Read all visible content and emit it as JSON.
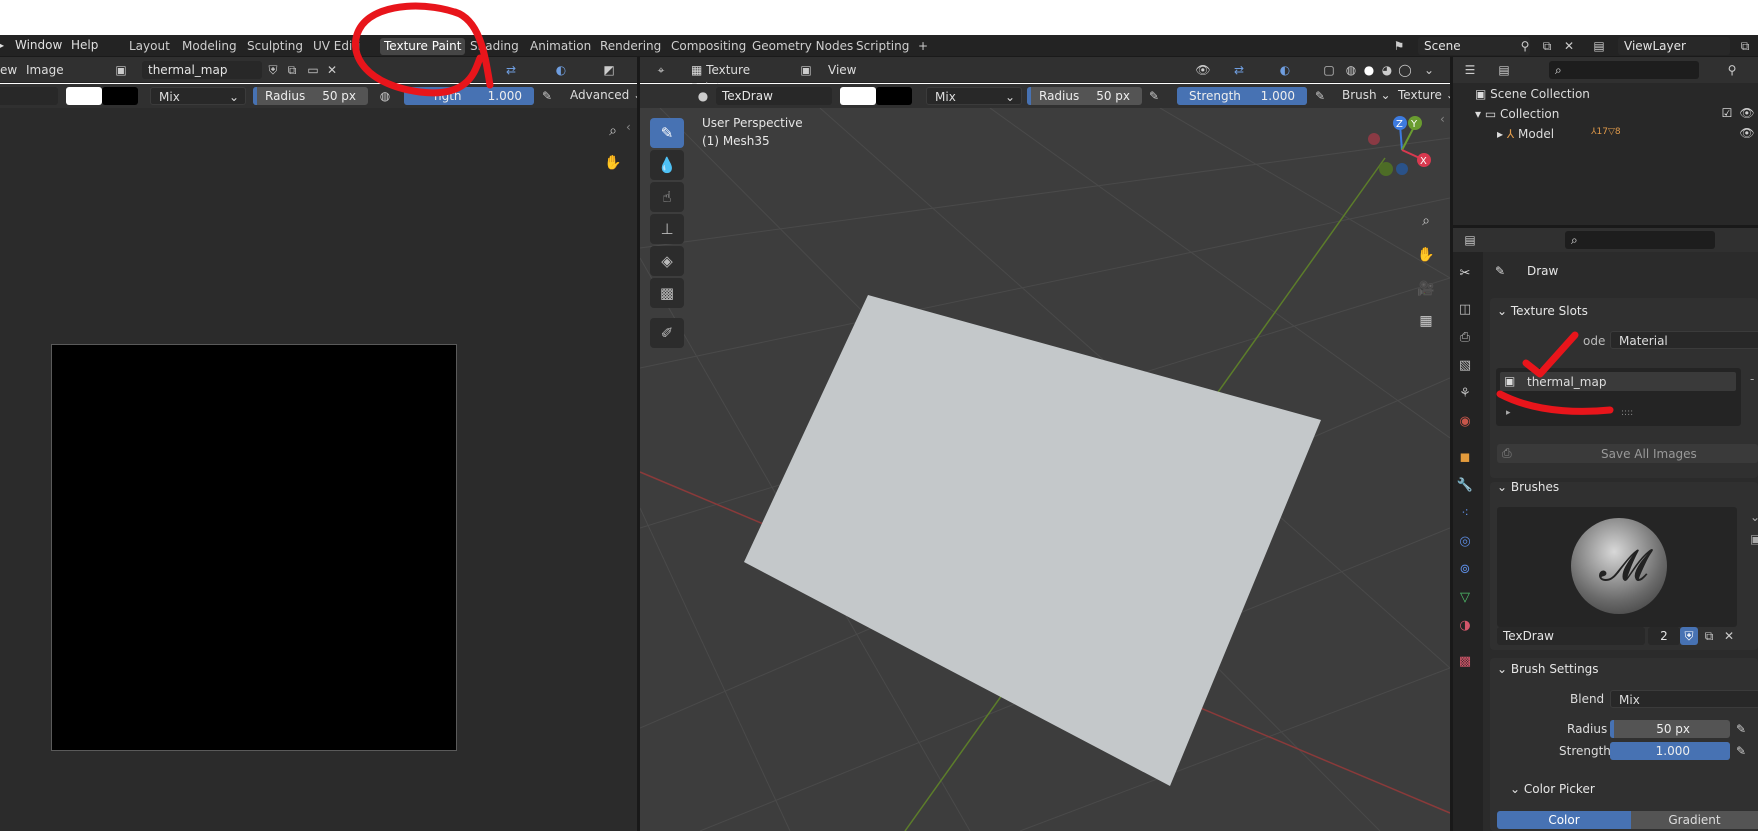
{
  "menu": {
    "items": [
      "Window",
      "Help"
    ]
  },
  "workspaces": [
    "Layout",
    "Modeling",
    "Sculpting",
    "UV Editi",
    "Texture Paint",
    "Shading",
    "Animation",
    "Rendering",
    "Compositing",
    "Geometry Nodes",
    "Scripting",
    "+"
  ],
  "scene": {
    "name": "Scene"
  },
  "view_layer": {
    "name": "ViewLayer"
  },
  "image_editor": {
    "menu_view": "ew",
    "menu_image": "Image",
    "image_name": "thermal_map",
    "blend": "Mix",
    "radius_label": "Radius",
    "radius_value": "50 px",
    "strength_label": "Strength",
    "strength_label_visible": "ngth",
    "strength_value": "1.000",
    "advanced": "Advanced"
  },
  "viewport": {
    "mode": "Texture Paint",
    "view_menu": "View",
    "brush_name": "TexDraw",
    "blend": "Mix",
    "radius_label": "Radius",
    "radius_value": "50 px",
    "strength_label": "Strength",
    "strength_value": "1.000",
    "brush_menu": "Brush",
    "texture_menu": "Texture",
    "perspective": "User Perspective",
    "object": "(1) Mesh35"
  },
  "outliner": {
    "scene_collection": "Scene Collection",
    "collection": "Collection",
    "model": "Model",
    "model_counts": "17",
    "model_counts2": "8"
  },
  "properties": {
    "tool_name": "Draw",
    "texture_slots": {
      "title": "Texture Slots",
      "mode_label": "ode",
      "mode_value": "Material",
      "slot": "thermal_map",
      "save_all": "Save All Images",
      "dots": "::::"
    },
    "brushes": {
      "title": "Brushes",
      "brush_name": "TexDraw",
      "users": "2"
    },
    "brush_settings": {
      "title": "Brush Settings",
      "blend_label": "Blend",
      "blend_value": "Mix",
      "radius_label": "Radius",
      "radius_value": "50 px",
      "strength_label": "Strength",
      "strength_value": "1.000",
      "strength_fraction": 1.0
    },
    "color_picker": {
      "title": "Color Picker",
      "color_tab": "Color",
      "gradient_tab": "Gradient"
    }
  },
  "colors": {
    "accent": "#4772b3",
    "annotation": "#e8151b",
    "background": "#3d3d3d"
  }
}
